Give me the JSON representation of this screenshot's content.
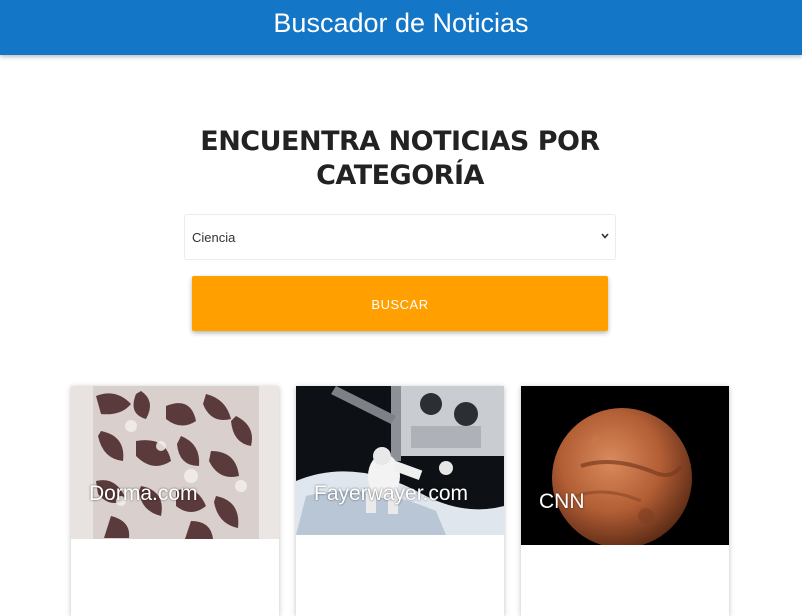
{
  "header": {
    "title": "Buscador de Noticias"
  },
  "heading": {
    "line1": "ENCUENTRA NOTICIAS POR",
    "line2": "CATEGORÍA"
  },
  "category_select": {
    "selected": "Ciencia"
  },
  "search_button": {
    "label": "BUSCAR"
  },
  "colors": {
    "header": "#1476c6",
    "button": "#ff9f00"
  },
  "cards": [
    {
      "source": "Dorma.com",
      "image": "escher-style animal tessellation"
    },
    {
      "source": "Fayerwayer.com",
      "image": "astronaut spacewalk on space station"
    },
    {
      "source": "CNN",
      "image": "planet mars"
    }
  ]
}
